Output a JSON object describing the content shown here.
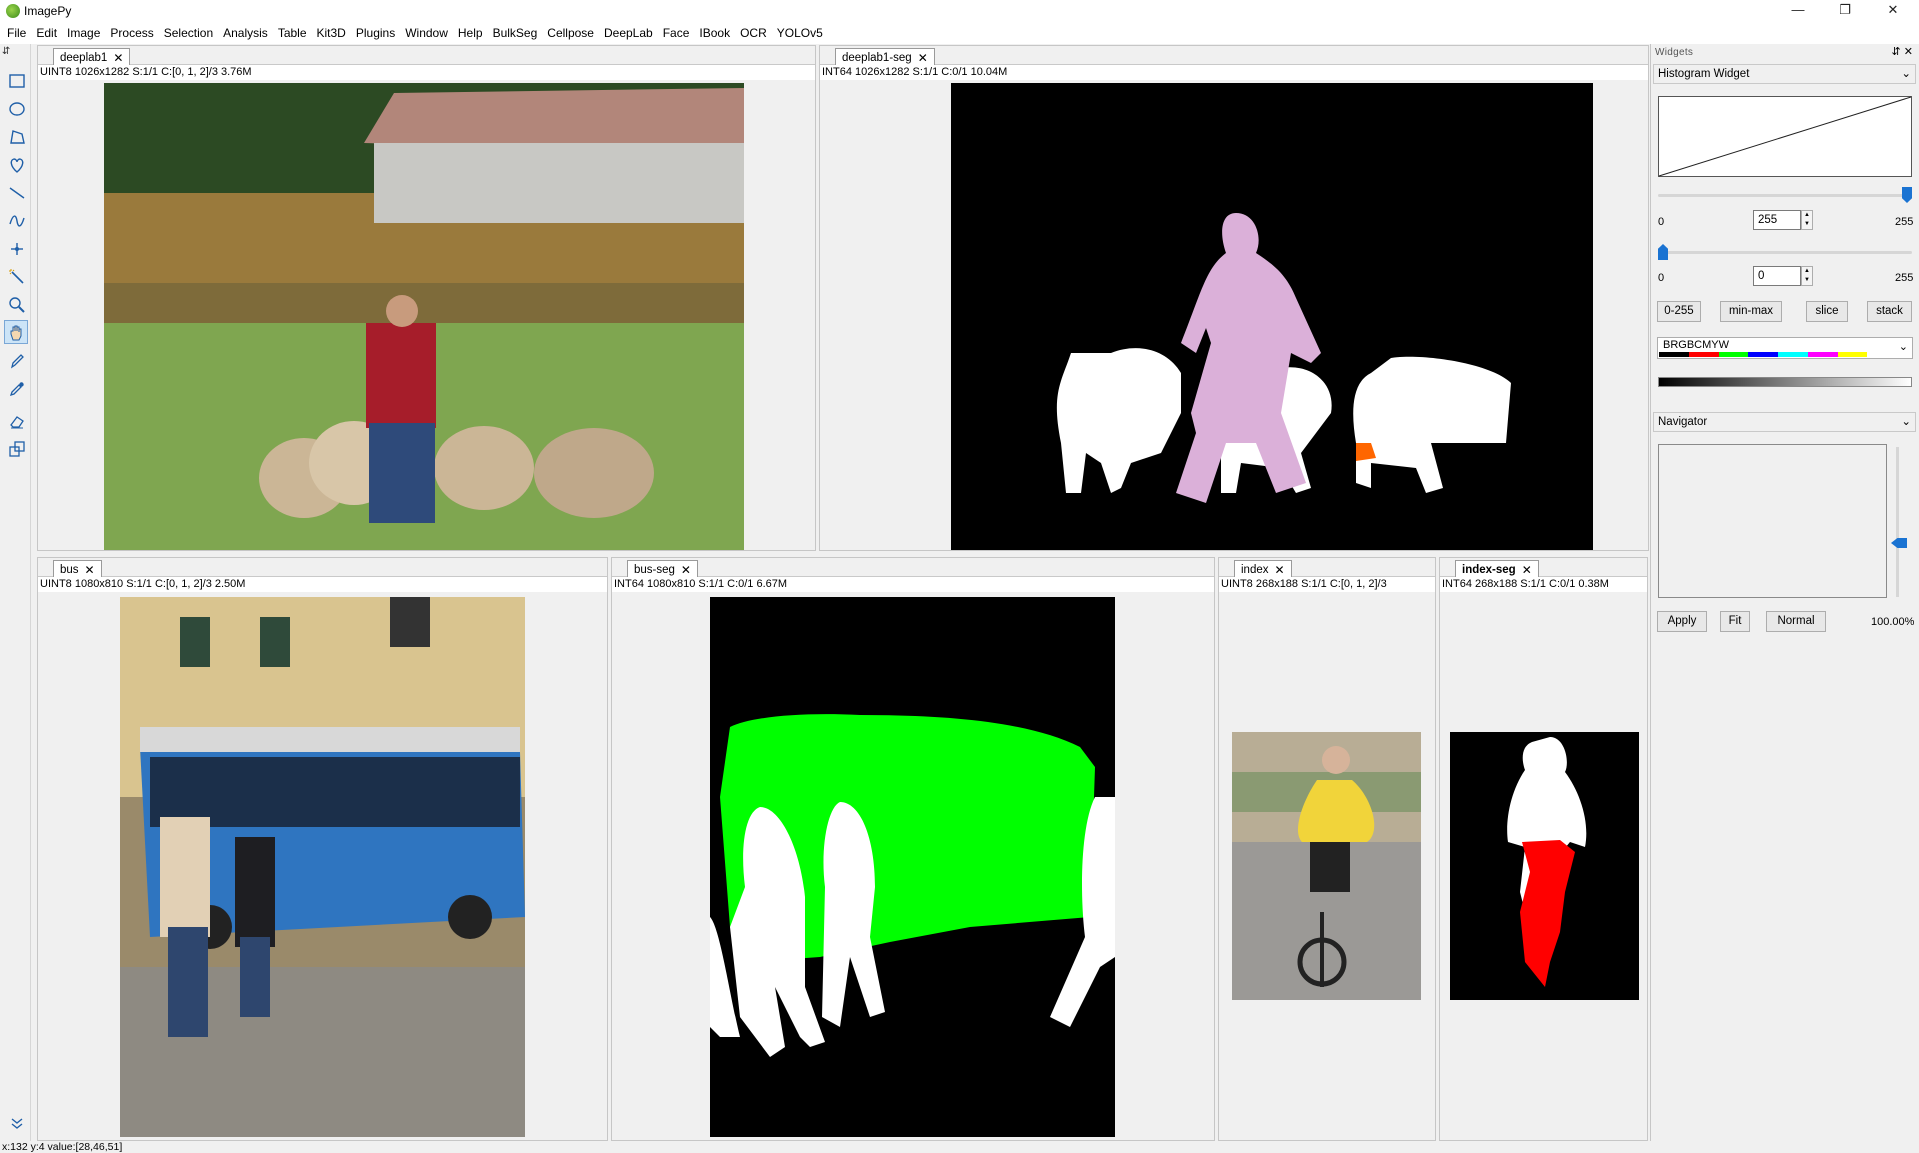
{
  "window": {
    "title": "ImagePy",
    "min": "—",
    "max": "❐",
    "close": "✕"
  },
  "menu": [
    "File",
    "Edit",
    "Image",
    "Process",
    "Selection",
    "Analysis",
    "Table",
    "Kit3D",
    "Plugins",
    "Window",
    "Help",
    "BulkSeg",
    "Cellpose",
    "DeepLab",
    "Face",
    "IBook",
    "OCR",
    "YOLOv5"
  ],
  "toolbar": {
    "grip": "⇵"
  },
  "panels": {
    "deeplab1": {
      "tab": "deeplab1",
      "info": "UINT8  1026x1282  S:1/1  C:[0, 1, 2]/3  3.76M"
    },
    "deeplab1_seg": {
      "tab": "deeplab1-seg",
      "info": "INT64  1026x1282  S:1/1  C:0/1  10.04M"
    },
    "bus": {
      "tab": "bus",
      "info": "UINT8  1080x810  S:1/1  C:[0, 1, 2]/3  2.50M"
    },
    "bus_seg": {
      "tab": "bus-seg",
      "info": "INT64  1080x810  S:1/1  C:0/1  6.67M"
    },
    "index": {
      "tab": "index",
      "info": "UINT8  268x188  S:1/1  C:[0, 1, 2]/3"
    },
    "index_seg": {
      "tab": "index-seg",
      "info": "INT64  268x188  S:1/1  C:0/1  0.38M"
    }
  },
  "widgets": {
    "title": "Widgets",
    "histogram": {
      "section": "Histogram Widget",
      "hi_min": "0",
      "hi_value": "255",
      "hi_max": "255",
      "lo_min": "0",
      "lo_value": "0",
      "lo_max": "255",
      "buttons": [
        "0-255",
        "min-max",
        "slice",
        "stack"
      ],
      "colormap": "BRGBCMYW",
      "colormap_colors": [
        "#000000",
        "#ff0000",
        "#00ff00",
        "#0000ff",
        "#00ffff",
        "#ff00ff",
        "#ffff00",
        "#ffffff"
      ]
    },
    "navigator": {
      "section": "Navigator",
      "buttons": [
        "Apply",
        "Fit",
        "Normal"
      ],
      "zoom": "100.00%"
    }
  },
  "status": "x:132 y:4  value:[28,46,51]",
  "colors": {
    "person_seg": "#dbb0d9",
    "bus_seg": "#00ff00",
    "bike_seg": "#ff0000",
    "dog_seg": "#ff6600",
    "accent": "#1a73d2"
  }
}
